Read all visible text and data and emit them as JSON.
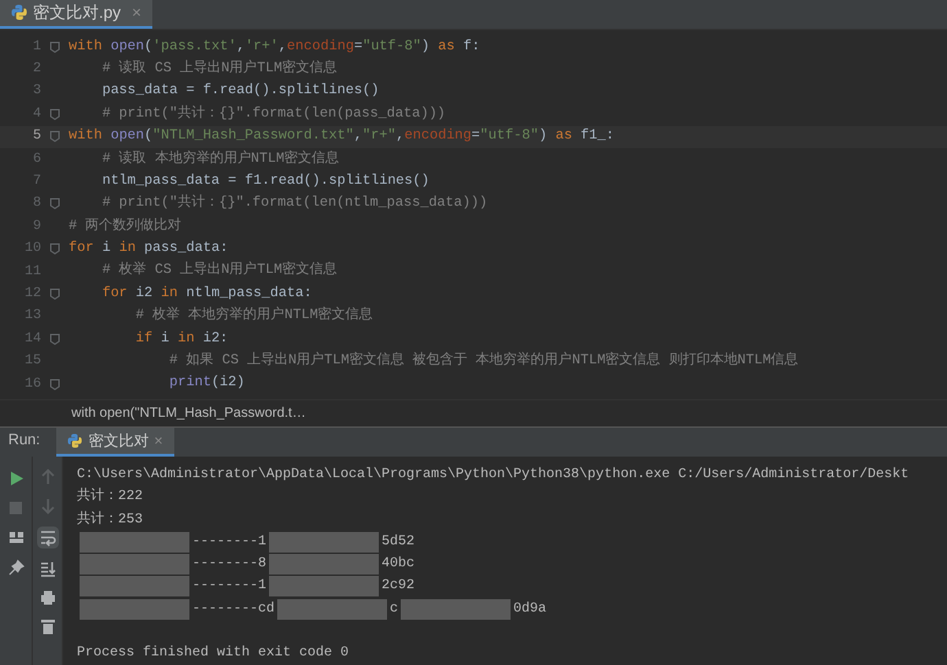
{
  "editor_tab": {
    "title": "密文比对.py",
    "close": "×"
  },
  "code_lines": [
    {
      "number": "1",
      "current": false,
      "fold": true,
      "tokens": [
        {
          "t": "with ",
          "kind": "kw"
        },
        {
          "t": "open",
          "kind": "fn"
        },
        {
          "t": "(",
          "kind": "plain"
        },
        {
          "t": "'pass.txt'",
          "kind": "str"
        },
        {
          "t": ",",
          "kind": "plain"
        },
        {
          "t": "'r+'",
          "kind": "str"
        },
        {
          "t": ",",
          "kind": "plain"
        },
        {
          "t": "encoding",
          "kind": "param"
        },
        {
          "t": "=",
          "kind": "plain"
        },
        {
          "t": "\"utf-8\"",
          "kind": "str"
        },
        {
          "t": ") ",
          "kind": "plain"
        },
        {
          "t": "as",
          "kind": "kw"
        },
        {
          "t": " f:",
          "kind": "plain"
        }
      ]
    },
    {
      "number": "2",
      "current": false,
      "fold": false,
      "tokens": [
        {
          "t": "    # 读取 CS 上导出N用户TLM密文信息",
          "kind": "comment"
        }
      ]
    },
    {
      "number": "3",
      "current": false,
      "fold": false,
      "tokens": [
        {
          "t": "    pass_data = f.read().splitlines()",
          "kind": "plain"
        }
      ]
    },
    {
      "number": "4",
      "current": false,
      "fold": true,
      "tokens": [
        {
          "t": "    # print(\"共计：{}\".format(len(pass_data)))",
          "kind": "comment"
        }
      ]
    },
    {
      "number": "5",
      "current": true,
      "fold": true,
      "tokens": [
        {
          "t": "with ",
          "kind": "kw"
        },
        {
          "t": "open",
          "kind": "fn"
        },
        {
          "t": "(",
          "kind": "plain"
        },
        {
          "t": "\"NTLM_Hash_Password.txt\"",
          "kind": "str"
        },
        {
          "t": ",",
          "kind": "plain"
        },
        {
          "t": "\"r+\"",
          "kind": "str"
        },
        {
          "t": ",",
          "kind": "plain"
        },
        {
          "t": "encoding",
          "kind": "param"
        },
        {
          "t": "=",
          "kind": "plain"
        },
        {
          "t": "\"utf-8\"",
          "kind": "str"
        },
        {
          "t": ") ",
          "kind": "plain"
        },
        {
          "t": "as",
          "kind": "kw"
        },
        {
          "t": " f1_:",
          "kind": "plain"
        }
      ]
    },
    {
      "number": "6",
      "current": false,
      "fold": false,
      "tokens": [
        {
          "t": "    # 读取 本地穷举的用户NTLM密文信息",
          "kind": "comment"
        }
      ]
    },
    {
      "number": "7",
      "current": false,
      "fold": false,
      "tokens": [
        {
          "t": "    ntlm_pass_data = f1.read().splitlines()",
          "kind": "plain"
        }
      ]
    },
    {
      "number": "8",
      "current": false,
      "fold": true,
      "tokens": [
        {
          "t": "    # print(\"共计：{}\".format(len(ntlm_pass_data)))",
          "kind": "comment"
        }
      ]
    },
    {
      "number": "9",
      "current": false,
      "fold": false,
      "tokens": [
        {
          "t": "# 两个数列做比对",
          "kind": "comment"
        }
      ]
    },
    {
      "number": "10",
      "current": false,
      "fold": true,
      "tokens": [
        {
          "t": "for ",
          "kind": "kw"
        },
        {
          "t": "i ",
          "kind": "plain"
        },
        {
          "t": "in ",
          "kind": "kw"
        },
        {
          "t": "pass_data:",
          "kind": "plain"
        }
      ]
    },
    {
      "number": "11",
      "current": false,
      "fold": false,
      "tokens": [
        {
          "t": "    # 枚举 CS 上导出N用户TLM密文信息",
          "kind": "comment"
        }
      ]
    },
    {
      "number": "12",
      "current": false,
      "fold": true,
      "tokens": [
        {
          "t": "    for ",
          "kind": "kw"
        },
        {
          "t": "i2 ",
          "kind": "plain"
        },
        {
          "t": "in ",
          "kind": "kw"
        },
        {
          "t": "ntlm_pass_data:",
          "kind": "plain"
        }
      ]
    },
    {
      "number": "13",
      "current": false,
      "fold": false,
      "tokens": [
        {
          "t": "        # 枚举 本地穷举的用户NTLM密文信息",
          "kind": "comment"
        }
      ]
    },
    {
      "number": "14",
      "current": false,
      "fold": true,
      "tokens": [
        {
          "t": "        if ",
          "kind": "kw"
        },
        {
          "t": "i ",
          "kind": "plain"
        },
        {
          "t": "in ",
          "kind": "kw"
        },
        {
          "t": "i2:",
          "kind": "plain"
        }
      ]
    },
    {
      "number": "15",
      "current": false,
      "fold": false,
      "tokens": [
        {
          "t": "            # 如果 CS 上导出N用户TLM密文信息 被包含于 本地穷举的用户NTLM密文信息 则打印本地NTLM信息",
          "kind": "comment"
        }
      ]
    },
    {
      "number": "16",
      "current": false,
      "fold": true,
      "tokens": [
        {
          "t": "            print",
          "kind": "fn"
        },
        {
          "t": "(i2)",
          "kind": "plain"
        }
      ]
    }
  ],
  "breadcrumb": "with open(\"NTLM_Hash_Password.t…",
  "run_panel": {
    "label": "Run:",
    "tab": {
      "title": "密文比对",
      "close": "×"
    },
    "output": [
      [
        {
          "kind": "text",
          "t": "C:\\Users\\Administrator\\AppData\\Local\\Programs\\Python\\Python38\\python.exe C:/Users/Administrator/Deskt"
        }
      ],
      [
        {
          "kind": "text",
          "t": "共计：222"
        }
      ],
      [
        {
          "kind": "text",
          "t": "共计：253"
        }
      ],
      [
        {
          "kind": "redacted"
        },
        {
          "kind": "text",
          "t": "--------1"
        },
        {
          "kind": "redacted"
        },
        {
          "kind": "text",
          "t": "5d52"
        }
      ],
      [
        {
          "kind": "redacted"
        },
        {
          "kind": "text",
          "t": "--------8"
        },
        {
          "kind": "redacted"
        },
        {
          "kind": "text",
          "t": "40bc"
        }
      ],
      [
        {
          "kind": "redacted"
        },
        {
          "kind": "text",
          "t": "--------1"
        },
        {
          "kind": "redacted"
        },
        {
          "kind": "text",
          "t": "2c92"
        }
      ],
      [
        {
          "kind": "redacted"
        },
        {
          "kind": "text",
          "t": "--------cd"
        },
        {
          "kind": "redacted"
        },
        {
          "kind": "text",
          "t": "c"
        },
        {
          "kind": "redacted"
        },
        {
          "kind": "text",
          "t": "0d9a"
        }
      ],
      [
        {
          "kind": "blank"
        }
      ],
      [
        {
          "kind": "text",
          "t": "Process finished with exit code 0"
        }
      ]
    ]
  }
}
